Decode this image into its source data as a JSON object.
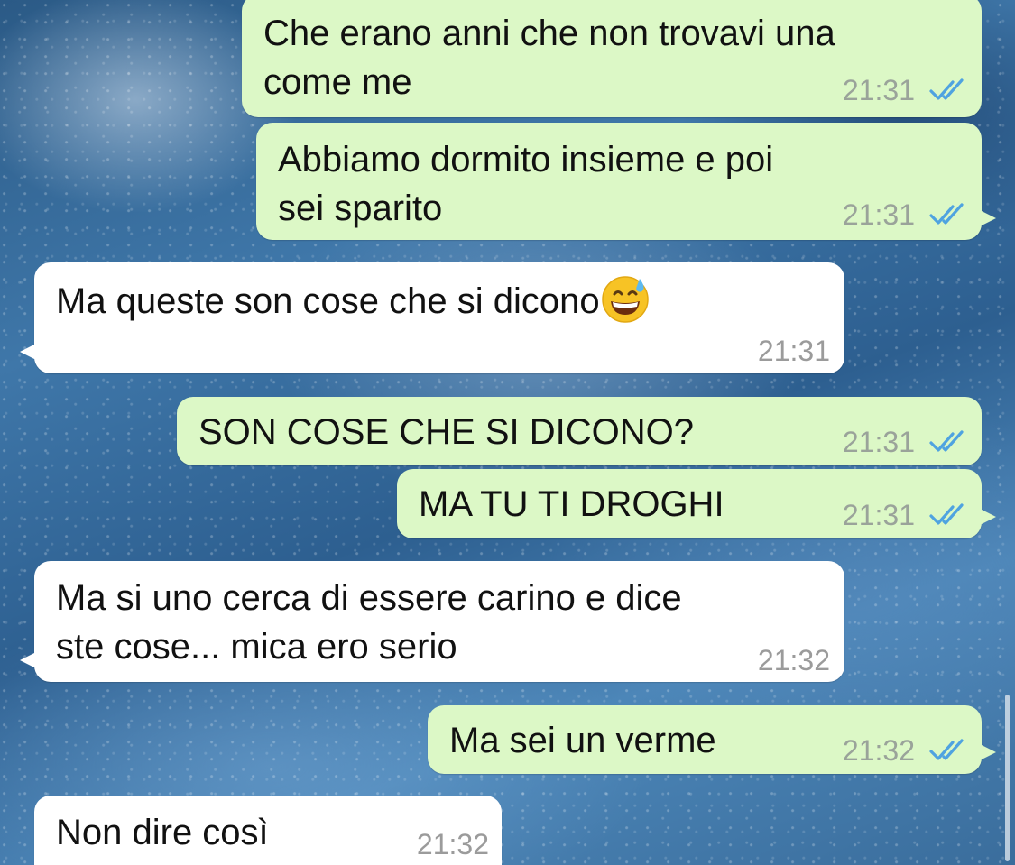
{
  "chat": {
    "messages": [
      {
        "direction": "outgoing",
        "text": "Che erano anni che non trovavi una\ncome me",
        "time": "21:31",
        "status": "read-icon"
      },
      {
        "direction": "outgoing",
        "text": "Abbiamo dormito insieme e poi\nsei sparito",
        "time": "21:31",
        "status": "read-icon"
      },
      {
        "direction": "incoming",
        "text": "Ma queste son cose che si dicono",
        "emoji": "grinning-face-with-sweat-emoji",
        "time": "21:31"
      },
      {
        "direction": "outgoing",
        "text": "SON COSE CHE SI DICONO?",
        "time": "21:31",
        "status": "read-icon"
      },
      {
        "direction": "outgoing",
        "text": "MA TU TI DROGHI",
        "time": "21:31",
        "status": "read-icon"
      },
      {
        "direction": "incoming",
        "text": "Ma si uno cerca di essere carino e dice\nste cose... mica ero serio",
        "time": "21:32"
      },
      {
        "direction": "outgoing",
        "text": "Ma sei un verme",
        "time": "21:32",
        "status": "read-icon"
      },
      {
        "direction": "incoming",
        "text": "Non dire così",
        "time": "21:32"
      }
    ]
  },
  "colors": {
    "outgoing_bubble": "#dcf8c6",
    "incoming_bubble": "#ffffff",
    "read_ticks": "#4fa3e0"
  }
}
